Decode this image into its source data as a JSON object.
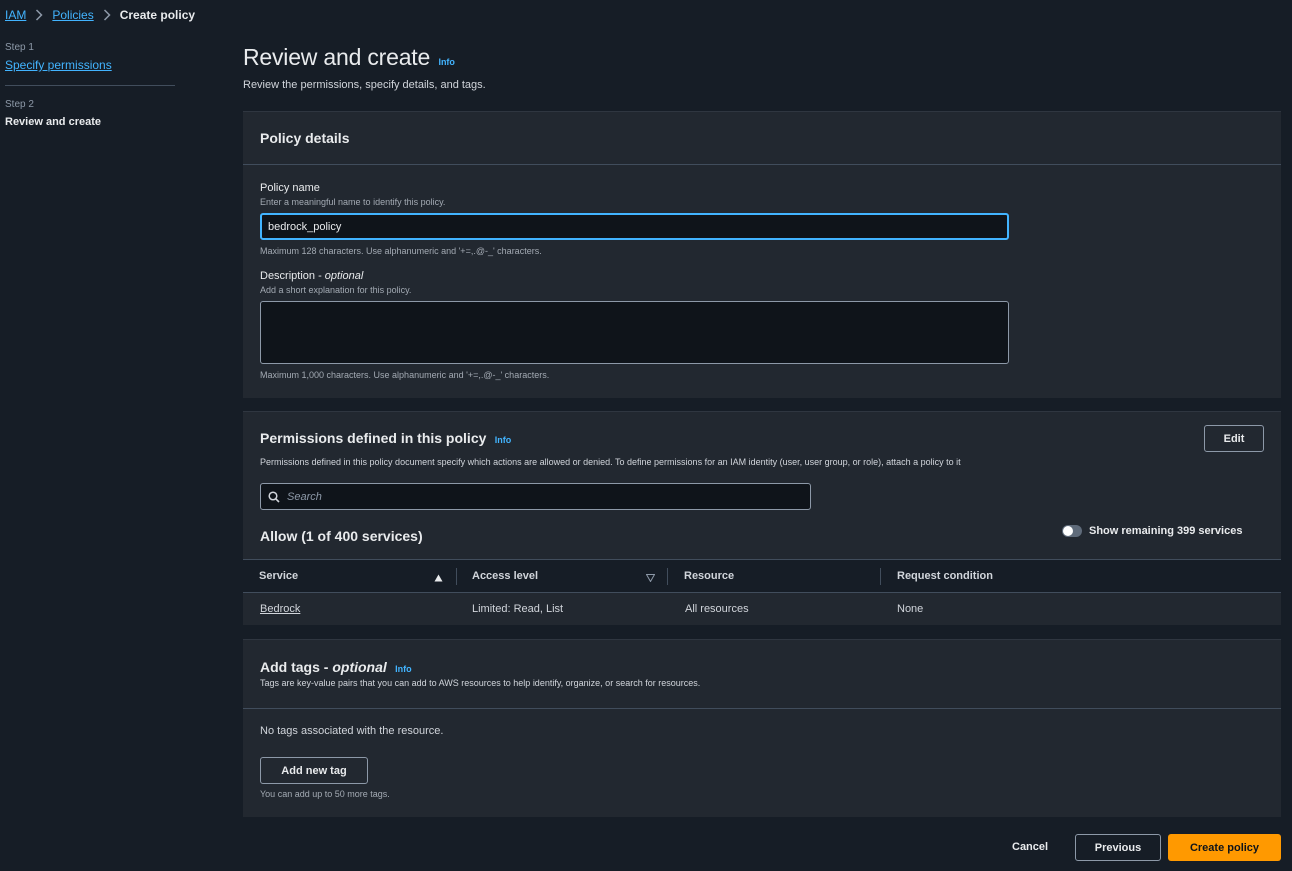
{
  "breadcrumb": {
    "items": [
      "IAM",
      "Policies"
    ],
    "current": "Create policy"
  },
  "steps": [
    {
      "num": "Step 1",
      "label": "Specify permissions"
    },
    {
      "num": "Step 2",
      "label": "Review and create"
    }
  ],
  "header": {
    "title": "Review and create",
    "info": "Info",
    "description": "Review the permissions, specify details, and tags."
  },
  "policy_details": {
    "title": "Policy details",
    "name_label": "Policy name",
    "name_desc": "Enter a meaningful name to identify this policy.",
    "name_value": "bedrock_policy",
    "name_constraint": "Maximum 128 characters. Use alphanumeric and '+=,.@-_' characters.",
    "desc_label": "Description - ",
    "desc_optional": "optional",
    "desc_desc": "Add a short explanation for this policy.",
    "desc_value": "",
    "desc_constraint": "Maximum 1,000 characters. Use alphanumeric and '+=,.@-_' characters."
  },
  "permissions": {
    "title": "Permissions defined in this policy",
    "info": "Info",
    "edit_label": "Edit",
    "description": "Permissions defined in this policy document specify which actions are allowed or denied. To define permissions for an IAM identity (user, user group, or role), attach a policy to it",
    "search_placeholder": "Search",
    "allow_heading": "Allow (1 of 400 services)",
    "toggle_label": "Show remaining 399 services",
    "toggle_on": false,
    "columns": [
      "Service",
      "Access level",
      "Resource",
      "Request condition"
    ],
    "rows": [
      {
        "service": "Bedrock",
        "access": "Limited: Read, List",
        "resource": "All resources",
        "condition": "None"
      }
    ]
  },
  "tags": {
    "title": "Add tags - ",
    "title_optional": "optional",
    "info": "Info",
    "description": "Tags are key-value pairs that you can add to AWS resources to help identify, organize, or search for resources.",
    "empty": "No tags associated with the resource.",
    "add_label": "Add new tag",
    "limit": "You can add up to 50 more tags."
  },
  "footer": {
    "cancel": "Cancel",
    "previous": "Previous",
    "create": "Create policy"
  },
  "colors": {
    "background": "#161d26",
    "card": "#222830",
    "link": "#42b4ff",
    "primary": "#ff9900"
  }
}
